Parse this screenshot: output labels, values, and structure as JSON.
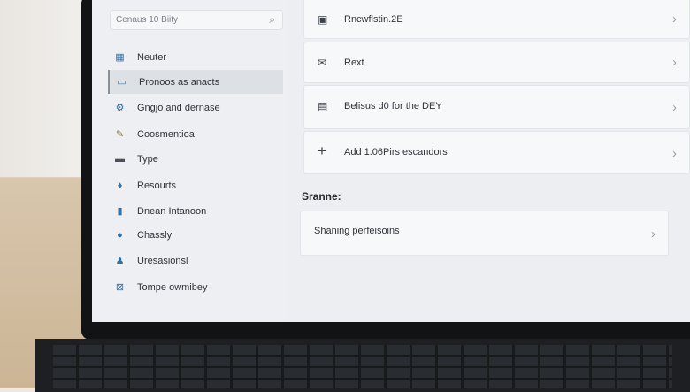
{
  "search": {
    "placeholder": "Cenaus 10 Biity"
  },
  "sidebar": {
    "items": [
      {
        "label": "Neuter",
        "icon": "grid-icon"
      },
      {
        "label": "Pronoos as anacts",
        "icon": "briefcase-icon",
        "active": true
      },
      {
        "label": "Gngjo and dernase",
        "icon": "gear-icon"
      },
      {
        "label": "Coosmentioa",
        "icon": "pen-icon"
      },
      {
        "label": "Type",
        "icon": "keyboard-icon"
      },
      {
        "label": "Resourts",
        "icon": "drop-icon"
      },
      {
        "label": "Dnean Intanoon",
        "icon": "folder-icon"
      },
      {
        "label": "Chassly",
        "icon": "circle-icon"
      },
      {
        "label": "Uresasionsl",
        "icon": "person-icon"
      },
      {
        "label": "Tompe owmibey",
        "icon": "x-box-icon"
      }
    ]
  },
  "main": {
    "cards": [
      {
        "label": "Rncwflstin.2E",
        "icon": "monitor-icon"
      },
      {
        "label": "Rext",
        "icon": "mail-icon"
      },
      {
        "label": "Belisus d0 for the DEY",
        "icon": "calendar-icon"
      },
      {
        "label": "Add 1:06Pirs escandors",
        "icon": "plus-icon"
      }
    ],
    "section_title": "Sranne:",
    "section_card": {
      "label": "Shaning perfeisoins"
    }
  }
}
